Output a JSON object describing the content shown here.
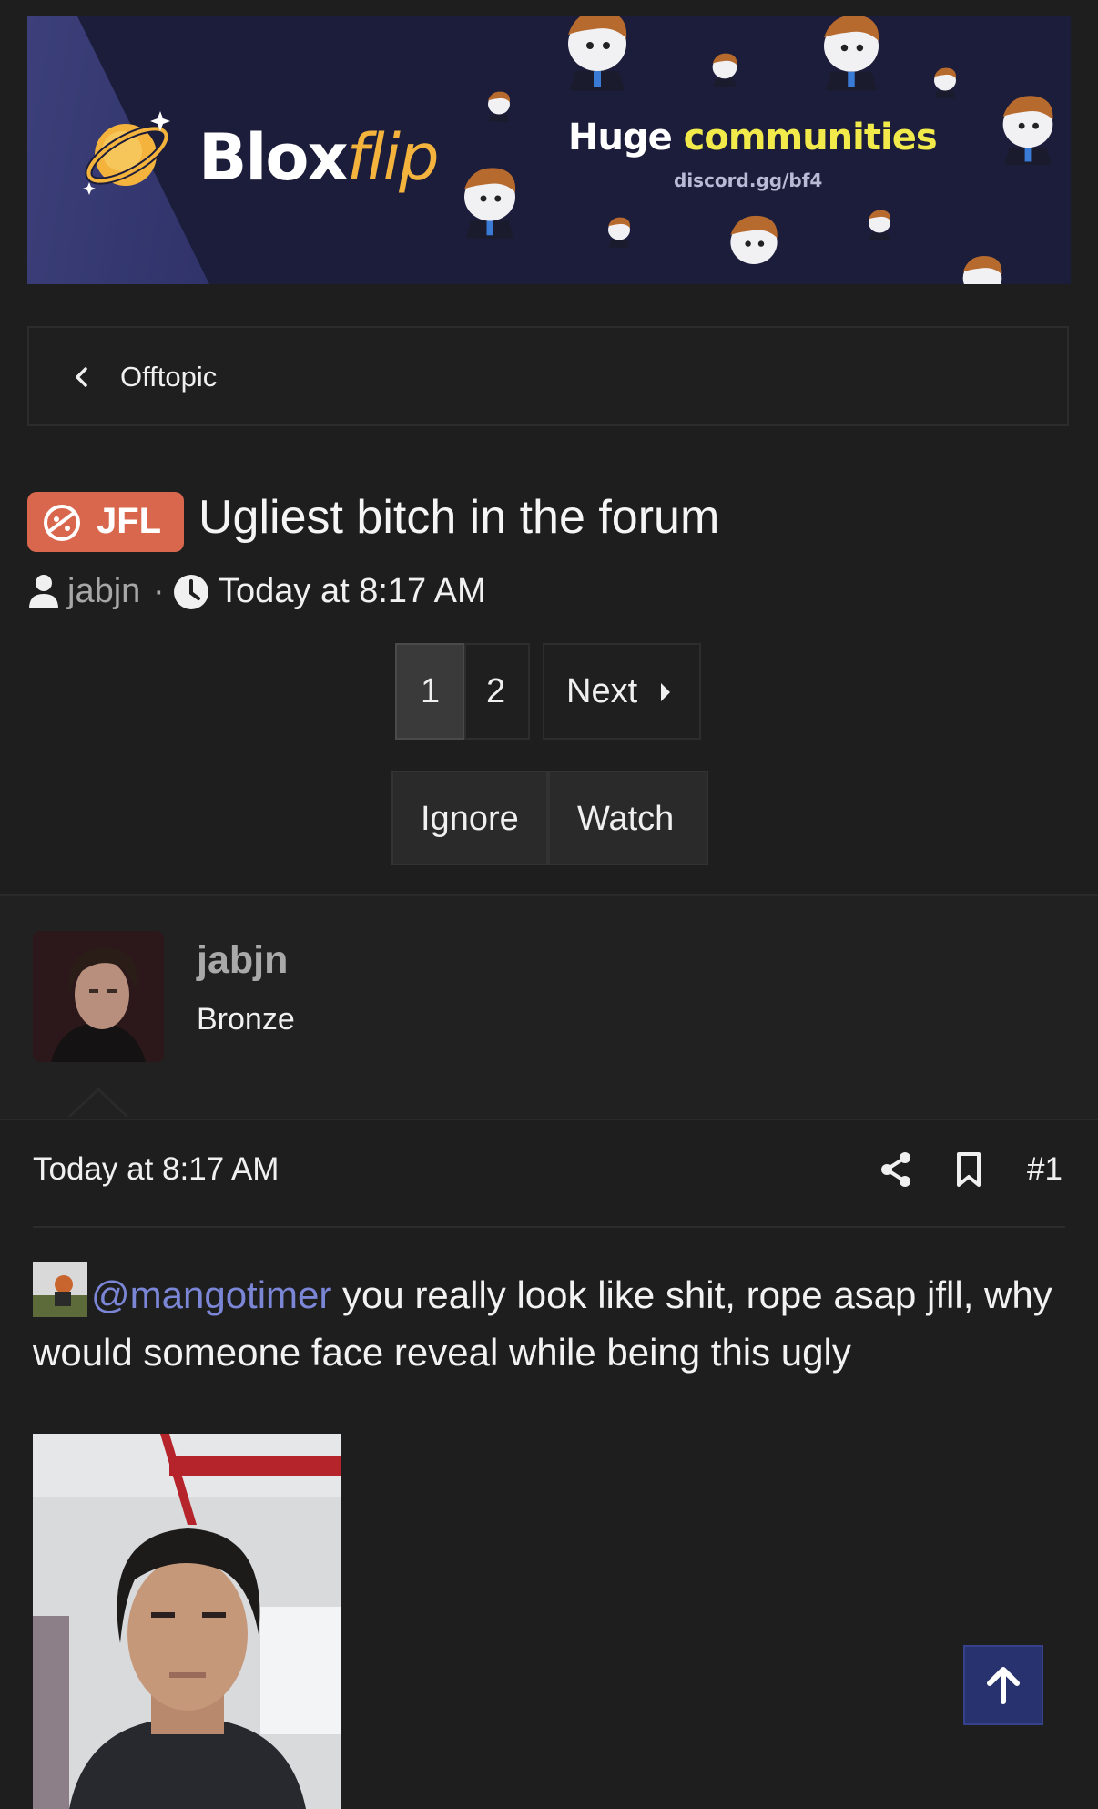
{
  "banner": {
    "brand_main": "Blox",
    "brand_flip": "flip",
    "headline_white": "Huge",
    "headline_accent": "communities",
    "invite": "discord.gg/bf4"
  },
  "breadcrumb": {
    "label": "Offtopic"
  },
  "thread": {
    "prefix": "JFL",
    "title": "Ugliest bitch in the forum",
    "author": "jabjn",
    "separator": "·",
    "time": "Today at 8:17 AM"
  },
  "pagination": {
    "pages": [
      "1",
      "2"
    ],
    "current": "1",
    "next": "Next"
  },
  "actions": {
    "ignore": "Ignore",
    "watch": "Watch"
  },
  "post": {
    "username": "jabjn",
    "rank": "Bronze",
    "time": "Today at 8:17 AM",
    "number": "#1",
    "mention": "@mangotimer",
    "text": " you really look like shit, rope asap jfll, why would someone face reveal while being this ugly"
  },
  "icons": {
    "breadcrumb": "chevron-left-icon",
    "author": "user-icon",
    "time": "clock-icon",
    "next": "caret-right-icon",
    "share": "share-icon",
    "bookmark": "bookmark-icon",
    "scroll_top": "arrow-up-icon"
  },
  "colors": {
    "background": "#1e1e1f",
    "prefix": "#d9674d",
    "mention": "#7b86d6",
    "banner": "#1c1d3a",
    "brand_accent": "#f3b33d",
    "headline_accent": "#f1ea4a",
    "scroll_top": "#27326f"
  }
}
